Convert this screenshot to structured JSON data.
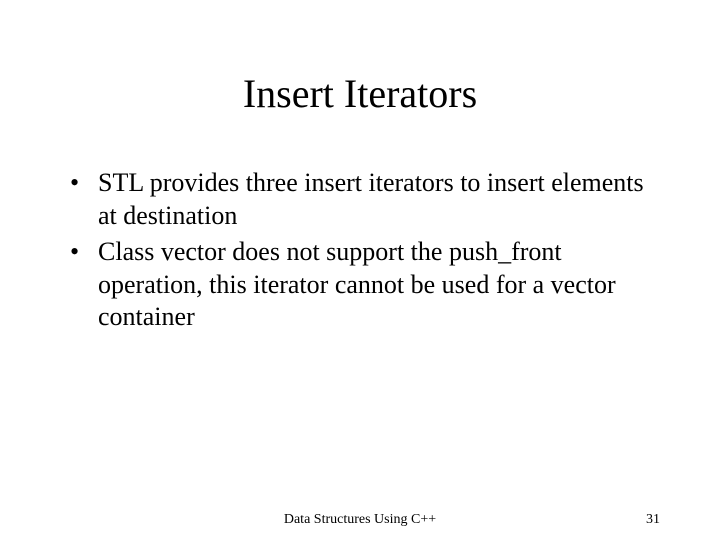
{
  "title": "Insert Iterators",
  "bullets": [
    "STL provides three insert iterators to insert elements at destination",
    "Class vector does not support the push_front operation, this iterator cannot be used for a vector container"
  ],
  "footer": {
    "center": "Data Structures Using C++",
    "page": "31"
  }
}
